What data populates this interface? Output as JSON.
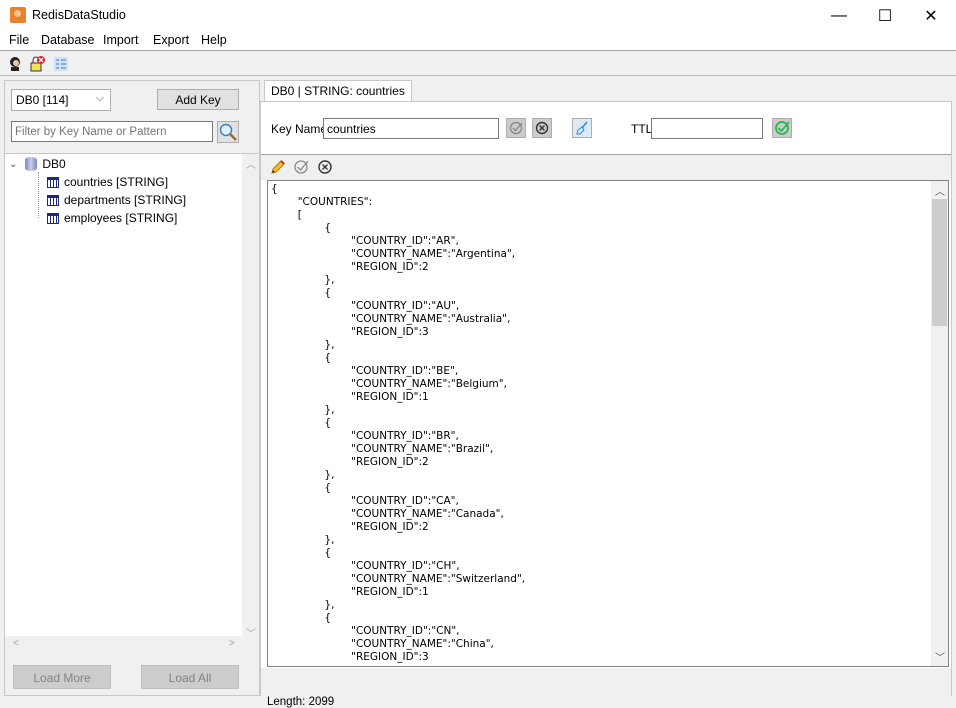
{
  "window": {
    "title": "RedisDataStudio",
    "controls": {
      "minimize": "—",
      "maximize": "☐",
      "close": "✕"
    }
  },
  "menu": [
    "File",
    "Database",
    "Import",
    "Export",
    "Help"
  ],
  "toolbar": {
    "icons": [
      "connect-user-icon",
      "disconnect-lock-icon",
      "list-view-icon"
    ]
  },
  "left": {
    "db_select": "DB0 [114]",
    "add_key": "Add Key",
    "filter_placeholder": "Filter by Key Name or Pattern",
    "tree": {
      "root": "DB0",
      "items": [
        "countries [STRING]",
        "departments [STRING]",
        "employees [STRING]"
      ]
    },
    "load_more": "Load More",
    "load_all": "Load All"
  },
  "right": {
    "tab": "DB0 | STRING: countries",
    "key_name_label": "Key Name",
    "key_name_value": "countries",
    "ttl_label": "TTL",
    "ttl_value": "",
    "editor_text": "{\n\t\"COUNTRIES\":\n\t[\n\t\t{\n\t\t\t\"COUNTRY_ID\":\"AR\",\n\t\t\t\"COUNTRY_NAME\":\"Argentina\",\n\t\t\t\"REGION_ID\":2\n\t\t},\n\t\t{\n\t\t\t\"COUNTRY_ID\":\"AU\",\n\t\t\t\"COUNTRY_NAME\":\"Australia\",\n\t\t\t\"REGION_ID\":3\n\t\t},\n\t\t{\n\t\t\t\"COUNTRY_ID\":\"BE\",\n\t\t\t\"COUNTRY_NAME\":\"Belgium\",\n\t\t\t\"REGION_ID\":1\n\t\t},\n\t\t{\n\t\t\t\"COUNTRY_ID\":\"BR\",\n\t\t\t\"COUNTRY_NAME\":\"Brazil\",\n\t\t\t\"REGION_ID\":2\n\t\t},\n\t\t{\n\t\t\t\"COUNTRY_ID\":\"CA\",\n\t\t\t\"COUNTRY_NAME\":\"Canada\",\n\t\t\t\"REGION_ID\":2\n\t\t},\n\t\t{\n\t\t\t\"COUNTRY_ID\":\"CH\",\n\t\t\t\"COUNTRY_NAME\":\"Switzerland\",\n\t\t\t\"REGION_ID\":1\n\t\t},\n\t\t{\n\t\t\t\"COUNTRY_ID\":\"CN\",\n\t\t\t\"COUNTRY_NAME\":\"China\",\n\t\t\t\"REGION_ID\":3",
    "status": "Length: 2099"
  }
}
